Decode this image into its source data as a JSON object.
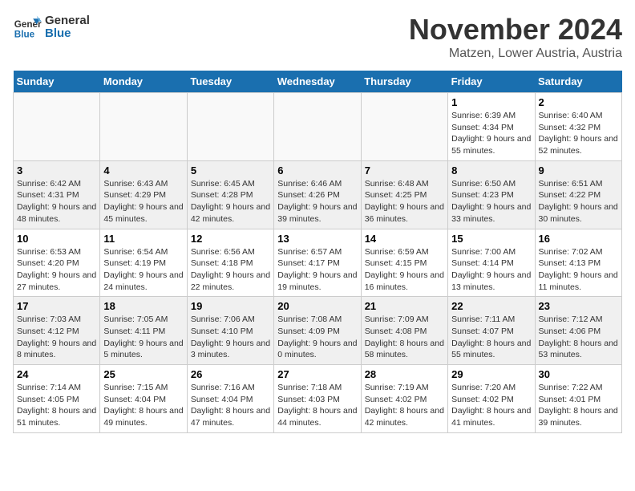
{
  "logo": {
    "line1": "General",
    "line2": "Blue"
  },
  "title": "November 2024",
  "subtitle": "Matzen, Lower Austria, Austria",
  "days_of_week": [
    "Sunday",
    "Monday",
    "Tuesday",
    "Wednesday",
    "Thursday",
    "Friday",
    "Saturday"
  ],
  "weeks": [
    [
      {
        "day": "",
        "info": ""
      },
      {
        "day": "",
        "info": ""
      },
      {
        "day": "",
        "info": ""
      },
      {
        "day": "",
        "info": ""
      },
      {
        "day": "",
        "info": ""
      },
      {
        "day": "1",
        "info": "Sunrise: 6:39 AM\nSunset: 4:34 PM\nDaylight: 9 hours and 55 minutes."
      },
      {
        "day": "2",
        "info": "Sunrise: 6:40 AM\nSunset: 4:32 PM\nDaylight: 9 hours and 52 minutes."
      }
    ],
    [
      {
        "day": "3",
        "info": "Sunrise: 6:42 AM\nSunset: 4:31 PM\nDaylight: 9 hours and 48 minutes."
      },
      {
        "day": "4",
        "info": "Sunrise: 6:43 AM\nSunset: 4:29 PM\nDaylight: 9 hours and 45 minutes."
      },
      {
        "day": "5",
        "info": "Sunrise: 6:45 AM\nSunset: 4:28 PM\nDaylight: 9 hours and 42 minutes."
      },
      {
        "day": "6",
        "info": "Sunrise: 6:46 AM\nSunset: 4:26 PM\nDaylight: 9 hours and 39 minutes."
      },
      {
        "day": "7",
        "info": "Sunrise: 6:48 AM\nSunset: 4:25 PM\nDaylight: 9 hours and 36 minutes."
      },
      {
        "day": "8",
        "info": "Sunrise: 6:50 AM\nSunset: 4:23 PM\nDaylight: 9 hours and 33 minutes."
      },
      {
        "day": "9",
        "info": "Sunrise: 6:51 AM\nSunset: 4:22 PM\nDaylight: 9 hours and 30 minutes."
      }
    ],
    [
      {
        "day": "10",
        "info": "Sunrise: 6:53 AM\nSunset: 4:20 PM\nDaylight: 9 hours and 27 minutes."
      },
      {
        "day": "11",
        "info": "Sunrise: 6:54 AM\nSunset: 4:19 PM\nDaylight: 9 hours and 24 minutes."
      },
      {
        "day": "12",
        "info": "Sunrise: 6:56 AM\nSunset: 4:18 PM\nDaylight: 9 hours and 22 minutes."
      },
      {
        "day": "13",
        "info": "Sunrise: 6:57 AM\nSunset: 4:17 PM\nDaylight: 9 hours and 19 minutes."
      },
      {
        "day": "14",
        "info": "Sunrise: 6:59 AM\nSunset: 4:15 PM\nDaylight: 9 hours and 16 minutes."
      },
      {
        "day": "15",
        "info": "Sunrise: 7:00 AM\nSunset: 4:14 PM\nDaylight: 9 hours and 13 minutes."
      },
      {
        "day": "16",
        "info": "Sunrise: 7:02 AM\nSunset: 4:13 PM\nDaylight: 9 hours and 11 minutes."
      }
    ],
    [
      {
        "day": "17",
        "info": "Sunrise: 7:03 AM\nSunset: 4:12 PM\nDaylight: 9 hours and 8 minutes."
      },
      {
        "day": "18",
        "info": "Sunrise: 7:05 AM\nSunset: 4:11 PM\nDaylight: 9 hours and 5 minutes."
      },
      {
        "day": "19",
        "info": "Sunrise: 7:06 AM\nSunset: 4:10 PM\nDaylight: 9 hours and 3 minutes."
      },
      {
        "day": "20",
        "info": "Sunrise: 7:08 AM\nSunset: 4:09 PM\nDaylight: 9 hours and 0 minutes."
      },
      {
        "day": "21",
        "info": "Sunrise: 7:09 AM\nSunset: 4:08 PM\nDaylight: 8 hours and 58 minutes."
      },
      {
        "day": "22",
        "info": "Sunrise: 7:11 AM\nSunset: 4:07 PM\nDaylight: 8 hours and 55 minutes."
      },
      {
        "day": "23",
        "info": "Sunrise: 7:12 AM\nSunset: 4:06 PM\nDaylight: 8 hours and 53 minutes."
      }
    ],
    [
      {
        "day": "24",
        "info": "Sunrise: 7:14 AM\nSunset: 4:05 PM\nDaylight: 8 hours and 51 minutes."
      },
      {
        "day": "25",
        "info": "Sunrise: 7:15 AM\nSunset: 4:04 PM\nDaylight: 8 hours and 49 minutes."
      },
      {
        "day": "26",
        "info": "Sunrise: 7:16 AM\nSunset: 4:04 PM\nDaylight: 8 hours and 47 minutes."
      },
      {
        "day": "27",
        "info": "Sunrise: 7:18 AM\nSunset: 4:03 PM\nDaylight: 8 hours and 44 minutes."
      },
      {
        "day": "28",
        "info": "Sunrise: 7:19 AM\nSunset: 4:02 PM\nDaylight: 8 hours and 42 minutes."
      },
      {
        "day": "29",
        "info": "Sunrise: 7:20 AM\nSunset: 4:02 PM\nDaylight: 8 hours and 41 minutes."
      },
      {
        "day": "30",
        "info": "Sunrise: 7:22 AM\nSunset: 4:01 PM\nDaylight: 8 hours and 39 minutes."
      }
    ]
  ]
}
